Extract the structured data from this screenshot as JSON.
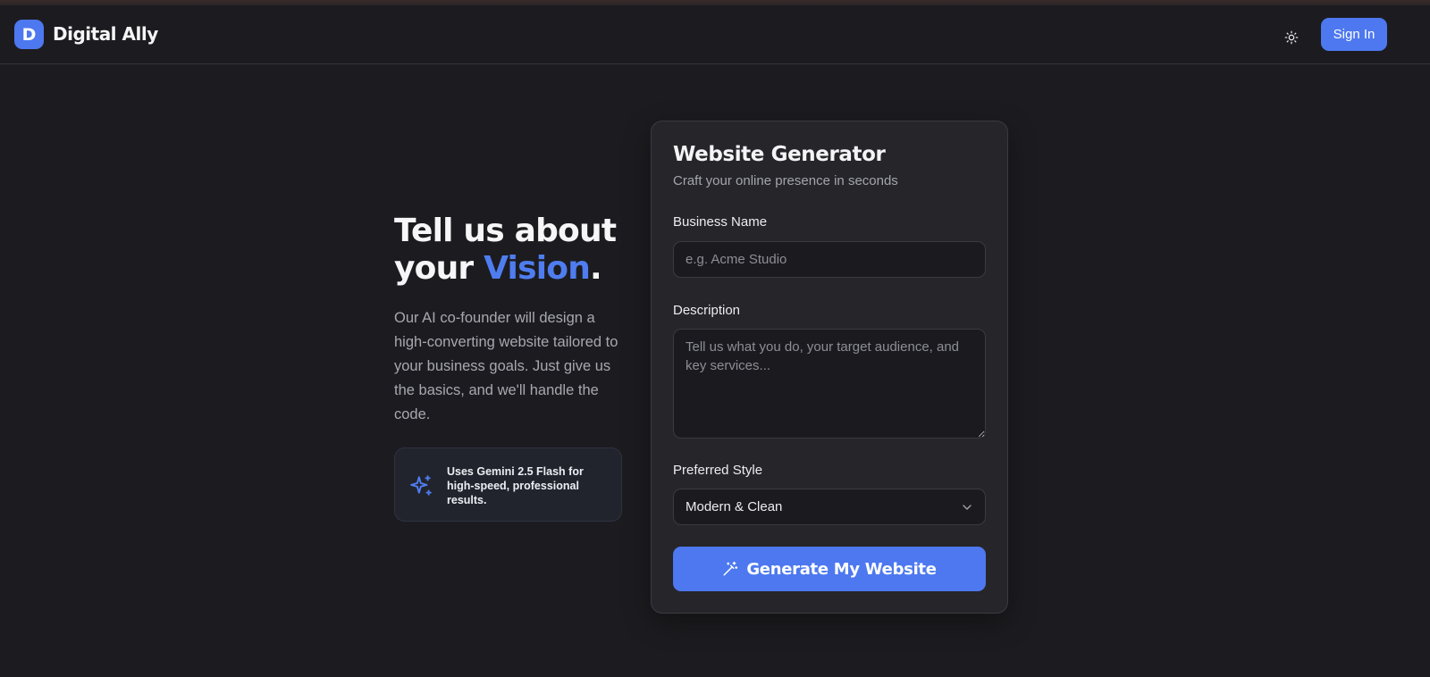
{
  "header": {
    "logo_letter": "D",
    "app_name": "Digital Ally",
    "theme_icon": "sun-icon",
    "sign_in_label": "Sign In"
  },
  "hero": {
    "title_part1": "Tell us about",
    "title_part2": "your ",
    "title_accent": "Vision",
    "title_end": ".",
    "description": "Our AI co-founder will design a high-converting website tailored to your business goals. Just give us the basics, and we'll handle the code.",
    "info_icon": "sparkles-icon",
    "info_text": "Uses Gemini 2.5 Flash for high-speed, professional results."
  },
  "form": {
    "title": "Website Generator",
    "subtitle": "Craft your online presence in seconds",
    "business_name": {
      "label": "Business Name",
      "value": "",
      "placeholder": "e.g. Acme Studio"
    },
    "description": {
      "label": "Description",
      "value": "",
      "placeholder": "Tell us what you do, your target audience, and key services..."
    },
    "style": {
      "label": "Preferred Style",
      "selected": "Modern & Clean",
      "icon": "chevron-down-icon"
    },
    "submit_label": "Generate My Website",
    "submit_icon": "magic-wand-icon"
  },
  "colors": {
    "accent": "#4d78ef",
    "background": "#1c1c20",
    "card": "#25252a"
  }
}
